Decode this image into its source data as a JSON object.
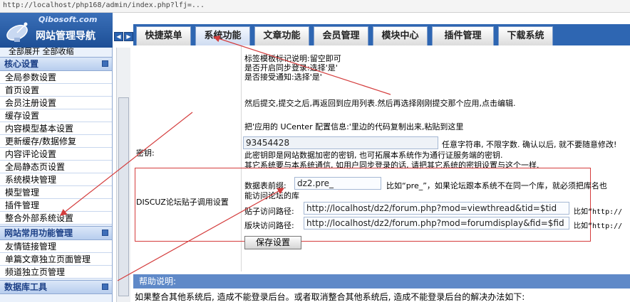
{
  "browser": {
    "url": "http://localhost/php168/admin/index.php?lfj=..."
  },
  "logo": {
    "site": "Qibosoft.com",
    "title": "网站管理导航"
  },
  "nav_arrows": {
    "left": "◀",
    "right": "▶"
  },
  "tabs": [
    {
      "label": "快捷菜单"
    },
    {
      "label": "系统功能"
    },
    {
      "label": "文章功能"
    },
    {
      "label": "会员管理"
    },
    {
      "label": "模块中心"
    },
    {
      "label": "插件管理"
    },
    {
      "label": "下载系统"
    }
  ],
  "sidebar": {
    "expand": "全部展开 全部收缩",
    "groups": [
      {
        "title": "核心设置",
        "items": [
          "全局参数设置",
          "首页设置",
          "会员注册设置",
          "缓存设置",
          "内容模型基本设置",
          "更新缓存/数据修复",
          "内容评论设置",
          "全局静态页设置",
          "系统模块管理",
          "模型管理",
          "插件管理",
          "整合外部系统设置"
        ]
      },
      {
        "title": "网站常用功能管理",
        "items": [
          "友情链接管理",
          "单篇文章独立页面管理",
          "频道独立页管理"
        ]
      },
      {
        "title": "数据库工具",
        "items": []
      }
    ]
  },
  "content": {
    "instructions": [
      "标签模板标记说明:留空即可",
      "是否开启同步登录:选择'是'",
      "是否接受通知:选择'是'",
      "然后提交,提交之后,再返回到应用列表.然后再选择刚刚提交那个应用,点击编辑.",
      "把'应用的 UCenter 配置信息:'里边的代码复制出来,粘贴到这里"
    ],
    "key_label": "密钥:",
    "key_value": "93454428",
    "key_hint1": "任意字符串, 不限字数. 确认以后, 就不要随意修改!",
    "key_hint2": "此密钥即是网站数据加密的密钥, 也可拓展本系统作为通行证服务端的密钥.",
    "key_hint3": "其它系统要与本系统通信, 如用户同步登录的话, 请把其它系统的密钥设置与这个一样.",
    "discuz_label": "DISCUZ论坛贴子调用设置",
    "prefix_label": "数据表前缀:",
    "prefix_value": "dz2.pre_",
    "prefix_hint": "比如“pre_”，如果论坛跟本系统不在同一个库，就必须把库名也",
    "prefix_hint2": "能访问论坛的库",
    "thread_label": "贴子访问路径:",
    "thread_value": "http://localhost/dz2/forum.php?mod=viewthread&tid=$tid",
    "thread_hint": "比如“http://",
    "forum_label": "版块访问路径:",
    "forum_value": "http://localhost/dz2/forum.php?mod=forumdisplay&fid=$fid",
    "forum_hint": "比如“http://",
    "save_label": "保存设置",
    "help_title": "帮助说明:",
    "help_text": "如果整合其他系统后, 造成不能登录后台。或者取消整合其他系统后, 造成不能登录后台的解决办法如下:"
  },
  "colors": {
    "accent": "#2e66b2",
    "annotation": "#d43c3c"
  }
}
